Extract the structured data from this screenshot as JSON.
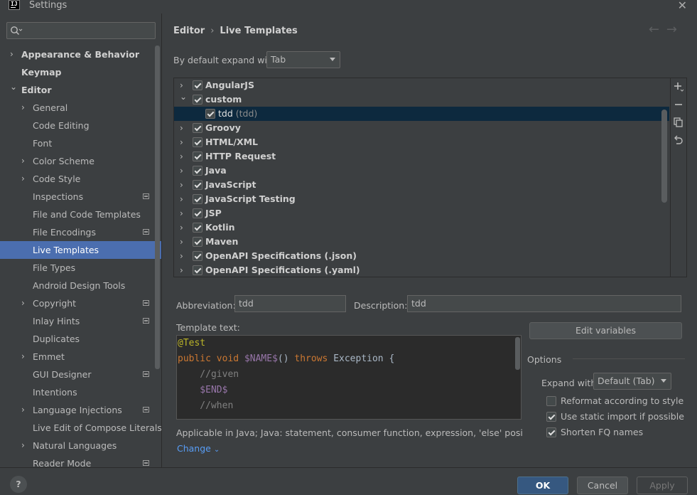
{
  "window": {
    "title": "Settings",
    "logo_text": "IJ"
  },
  "search": {
    "placeholder": "",
    "value": ""
  },
  "tree": {
    "items": [
      {
        "label": "Appearance & Behavior",
        "level": 0,
        "chevron": "right",
        "bold": true
      },
      {
        "label": "Keymap",
        "level": 0,
        "chevron": "none",
        "bold": true
      },
      {
        "label": "Editor",
        "level": 0,
        "chevron": "down",
        "bold": true
      },
      {
        "label": "General",
        "level": 1,
        "chevron": "right"
      },
      {
        "label": "Code Editing",
        "level": 1,
        "chevron": "none"
      },
      {
        "label": "Font",
        "level": 1,
        "chevron": "none"
      },
      {
        "label": "Color Scheme",
        "level": 1,
        "chevron": "right"
      },
      {
        "label": "Code Style",
        "level": 1,
        "chevron": "right"
      },
      {
        "label": "Inspections",
        "level": 1,
        "chevron": "none",
        "config_icon": true
      },
      {
        "label": "File and Code Templates",
        "level": 1,
        "chevron": "none"
      },
      {
        "label": "File Encodings",
        "level": 1,
        "chevron": "none",
        "config_icon": true
      },
      {
        "label": "Live Templates",
        "level": 1,
        "chevron": "none",
        "selected": true
      },
      {
        "label": "File Types",
        "level": 1,
        "chevron": "none"
      },
      {
        "label": "Android Design Tools",
        "level": 1,
        "chevron": "none"
      },
      {
        "label": "Copyright",
        "level": 1,
        "chevron": "right",
        "config_icon": true
      },
      {
        "label": "Inlay Hints",
        "level": 1,
        "chevron": "none",
        "config_icon": true
      },
      {
        "label": "Duplicates",
        "level": 1,
        "chevron": "none"
      },
      {
        "label": "Emmet",
        "level": 1,
        "chevron": "right"
      },
      {
        "label": "GUI Designer",
        "level": 1,
        "chevron": "none",
        "config_icon": true
      },
      {
        "label": "Intentions",
        "level": 1,
        "chevron": "none"
      },
      {
        "label": "Language Injections",
        "level": 1,
        "chevron": "right",
        "config_icon": true
      },
      {
        "label": "Live Edit of Compose Literals",
        "level": 1,
        "chevron": "none"
      },
      {
        "label": "Natural Languages",
        "level": 1,
        "chevron": "right"
      },
      {
        "label": "Reader Mode",
        "level": 1,
        "chevron": "none",
        "config_icon": true
      }
    ]
  },
  "breadcrumb": {
    "parent": "Editor",
    "current": "Live Templates",
    "back_icon": "arrow-left-icon",
    "forward_icon": "arrow-right-icon"
  },
  "expand": {
    "label": "By default expand with",
    "value": "Tab"
  },
  "templates": [
    {
      "name": "AngularJS",
      "chevron": "right",
      "checked": true,
      "level": 0
    },
    {
      "name": "custom",
      "chevron": "down",
      "checked": true,
      "level": 0
    },
    {
      "name": "tdd",
      "description": "(tdd)",
      "chevron": "none",
      "checked": true,
      "level": 1,
      "selected": true
    },
    {
      "name": "Groovy",
      "chevron": "right",
      "checked": true,
      "level": 0
    },
    {
      "name": "HTML/XML",
      "chevron": "right",
      "checked": true,
      "level": 0
    },
    {
      "name": "HTTP Request",
      "chevron": "right",
      "checked": true,
      "level": 0
    },
    {
      "name": "Java",
      "chevron": "right",
      "checked": true,
      "level": 0
    },
    {
      "name": "JavaScript",
      "chevron": "right",
      "checked": true,
      "level": 0
    },
    {
      "name": "JavaScript Testing",
      "chevron": "right",
      "checked": true,
      "level": 0
    },
    {
      "name": "JSP",
      "chevron": "right",
      "checked": true,
      "level": 0
    },
    {
      "name": "Kotlin",
      "chevron": "right",
      "checked": true,
      "level": 0
    },
    {
      "name": "Maven",
      "chevron": "right",
      "checked": true,
      "level": 0
    },
    {
      "name": "OpenAPI Specifications (.json)",
      "chevron": "right",
      "checked": true,
      "level": 0
    },
    {
      "name": "OpenAPI Specifications (.yaml)",
      "chevron": "right",
      "checked": true,
      "level": 0
    }
  ],
  "side_tools": [
    {
      "icon": "add-icon"
    },
    {
      "icon": "remove-icon"
    },
    {
      "icon": "copy-icon"
    },
    {
      "icon": "restore-icon"
    }
  ],
  "abbreviation": {
    "label": "Abbreviation:",
    "value": "tdd"
  },
  "description": {
    "label": "Description:",
    "value": "tdd"
  },
  "template_text": {
    "label": "Template text:",
    "lines": [
      [
        {
          "t": "@Test",
          "c": "ann"
        }
      ],
      [
        {
          "t": "public ",
          "c": "kw"
        },
        {
          "t": "void ",
          "c": "kw"
        },
        {
          "t": "$NAME$",
          "c": "var"
        },
        {
          "t": "() ",
          "c": ""
        },
        {
          "t": "throws ",
          "c": "kw"
        },
        {
          "t": "Exception {",
          "c": ""
        }
      ],
      [
        {
          "t": "    //given",
          "c": "cm"
        }
      ],
      [
        {
          "t": "    $END$",
          "c": "var"
        }
      ],
      [
        {
          "t": "    //when",
          "c": "cm"
        }
      ]
    ]
  },
  "edit_variables_label": "Edit variables",
  "options": {
    "title": "Options",
    "expand_with_label": "Expand with",
    "expand_with_value": "Default (Tab)",
    "checkboxes": [
      {
        "label": "Reformat according to style",
        "checked": false
      },
      {
        "label": "Use static import if possible",
        "checked": true
      },
      {
        "label": "Shorten FQ names",
        "checked": true
      }
    ]
  },
  "applicable": {
    "text": "Applicable in Java; Java: statement, consumer function, expression, 'else' position, declar...",
    "change_label": "Change"
  },
  "buttons": {
    "ok": "OK",
    "cancel": "Cancel",
    "apply": "Apply",
    "help": "?"
  },
  "colors": {
    "selection": "#4b6eaf",
    "list_selection": "#0d293e",
    "link": "#589df6",
    "primary_button": "#365880"
  }
}
